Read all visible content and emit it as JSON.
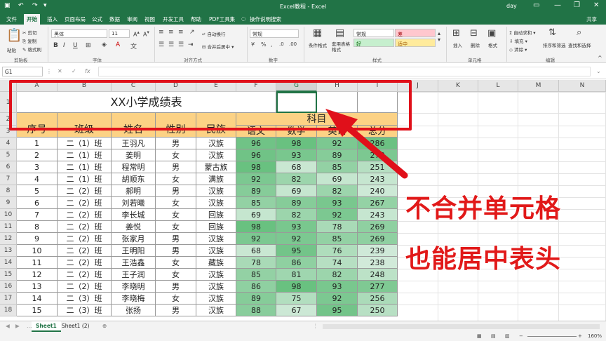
{
  "title_bar": {
    "window_title": "Excel教程 - Excel",
    "user": "day",
    "share": "共享"
  },
  "tabs": [
    "文件",
    "开始",
    "插入",
    "页面布局",
    "公式",
    "数据",
    "审阅",
    "视图",
    "开发工具",
    "帮助",
    "PDF工具集",
    "操作说明搜索"
  ],
  "ribbon": {
    "clipboard": {
      "cut": "剪切",
      "copy": "复制",
      "format_painter": "格式刷",
      "paste": "粘贴",
      "label": "剪贴板"
    },
    "font": {
      "name": "黑体",
      "size": "11",
      "label": "字体"
    },
    "alignment": {
      "wrap": "自动换行",
      "merge": "合并后居中",
      "label": "对齐方式"
    },
    "number": {
      "format": "常规",
      "label": "数字"
    },
    "styles": {
      "conditional": "条件格式",
      "table": "套用表格格式",
      "normal": "常规",
      "bad": "差",
      "good": "好",
      "neutral": "适中",
      "label": "样式"
    },
    "cells": {
      "insert": "插入",
      "delete": "删除",
      "format": "格式",
      "label": "单元格"
    },
    "editing": {
      "autosum": "自动求和",
      "fill": "填充",
      "clear": "清除",
      "sort": "排序和筛选",
      "find": "查找和选择",
      "label": "编辑"
    }
  },
  "formula_bar": {
    "name_box": "G1",
    "fx": "fx"
  },
  "columns": [
    "A",
    "B",
    "C",
    "D",
    "E",
    "F",
    "G",
    "H",
    "I",
    "J",
    "K",
    "L",
    "M",
    "N"
  ],
  "rows": [
    "1",
    "2",
    "3",
    "4",
    "5",
    "6",
    "7",
    "8",
    "9",
    "10",
    "11",
    "12",
    "13",
    "14",
    "15",
    "16",
    "17",
    "18"
  ],
  "table": {
    "title": "XX小学成绩表",
    "headers": [
      "序号",
      "班级",
      "姓名",
      "性别",
      "民族",
      "科目",
      "语文",
      "数学",
      "英语",
      "总分"
    ],
    "data": [
      [
        "1",
        "二（1）班",
        "王羽凡",
        "男",
        "汉族",
        "96",
        "98",
        "92",
        "286"
      ],
      [
        "2",
        "二（1）班",
        "姜明",
        "女",
        "汉族",
        "96",
        "93",
        "89",
        "278"
      ],
      [
        "3",
        "二（1）班",
        "程常明",
        "男",
        "蒙古族",
        "98",
        "68",
        "85",
        "251"
      ],
      [
        "4",
        "二（1）班",
        "胡顺东",
        "女",
        "满族",
        "92",
        "82",
        "69",
        "243"
      ],
      [
        "5",
        "二（2）班",
        "郝明",
        "男",
        "汉族",
        "89",
        "69",
        "82",
        "240"
      ],
      [
        "6",
        "二（2）班",
        "刘若曦",
        "女",
        "汉族",
        "85",
        "89",
        "93",
        "267"
      ],
      [
        "7",
        "二（2）班",
        "李长城",
        "女",
        "回族",
        "69",
        "82",
        "92",
        "243"
      ],
      [
        "8",
        "二（2）班",
        "姜悦",
        "女",
        "回族",
        "98",
        "93",
        "78",
        "269"
      ],
      [
        "9",
        "二（2）班",
        "张家月",
        "男",
        "汉族",
        "92",
        "92",
        "85",
        "269"
      ],
      [
        "10",
        "二（2）班",
        "王明阳",
        "男",
        "汉族",
        "68",
        "95",
        "76",
        "239"
      ],
      [
        "11",
        "二（2）班",
        "王浩鑫",
        "女",
        "藏族",
        "78",
        "86",
        "74",
        "238"
      ],
      [
        "12",
        "二（2）班",
        "王子润",
        "女",
        "汉族",
        "85",
        "81",
        "82",
        "248"
      ],
      [
        "13",
        "二（2）班",
        "李晓明",
        "男",
        "汉族",
        "86",
        "98",
        "93",
        "277"
      ],
      [
        "14",
        "二（3）班",
        "李晓梅",
        "女",
        "汉族",
        "89",
        "75",
        "92",
        "256"
      ],
      [
        "15",
        "二（3）班",
        "张扬",
        "男",
        "汉族",
        "88",
        "67",
        "95",
        "250"
      ]
    ]
  },
  "annotation": {
    "line1": "不合并单元格",
    "line2": "也能居中表头"
  },
  "sheets": [
    "Sheet1",
    "Sheet1 (2)"
  ],
  "status": {
    "zoom": "160%"
  },
  "colors": {
    "excel_green": "#217346",
    "header_fill": "#fcd285",
    "annotation_red": "#e11919"
  }
}
